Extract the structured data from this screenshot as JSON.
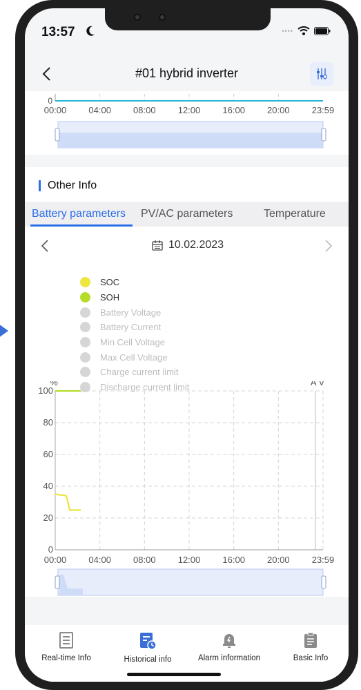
{
  "status": {
    "time": "13:57"
  },
  "header": {
    "title": "#01 hybrid inverter"
  },
  "top_chart": {
    "y_tick": "0",
    "x_ticks": [
      "00:00",
      "04:00",
      "08:00",
      "12:00",
      "16:00",
      "20:00",
      "23:59"
    ]
  },
  "section": {
    "title": "Other Info"
  },
  "tabs": [
    {
      "label": "Battery parameters",
      "active": true
    },
    {
      "label": "PV/AC parameters",
      "active": false
    },
    {
      "label": "Temperature",
      "active": false
    }
  ],
  "date": {
    "value": "10.02.2023"
  },
  "legend": [
    {
      "label": "SOC",
      "enabled": true,
      "color": "#ece63f"
    },
    {
      "label": "SOH",
      "enabled": true,
      "color": "#b5dc2a"
    },
    {
      "label": "Battery Voltage",
      "enabled": false,
      "color": "#d6d6d6"
    },
    {
      "label": "Battery Current",
      "enabled": false,
      "color": "#d6d6d6"
    },
    {
      "label": "Min Cell Voltage",
      "enabled": false,
      "color": "#d6d6d6"
    },
    {
      "label": "Max Cell Voltage",
      "enabled": false,
      "color": "#d6d6d6"
    },
    {
      "label": "Charge current limit",
      "enabled": false,
      "color": "#d6d6d6"
    },
    {
      "label": "Discharge current limit",
      "enabled": false,
      "color": "#d6d6d6"
    }
  ],
  "chart_data": {
    "type": "line",
    "ylabel_left": "%",
    "ylabel_right": "A V",
    "x_ticks": [
      "00:00",
      "04:00",
      "08:00",
      "12:00",
      "16:00",
      "20:00",
      "23:59"
    ],
    "y_ticks": [
      0,
      20,
      40,
      60,
      80,
      100
    ],
    "ylim": [
      0,
      100
    ],
    "xlim_hours": [
      0,
      24
    ],
    "grid": true,
    "series": [
      {
        "name": "SOC",
        "color": "#ece63f",
        "x_hours": [
          0,
          1.0,
          1.3,
          2.3
        ],
        "y": [
          35,
          34,
          25,
          25
        ]
      },
      {
        "name": "SOH",
        "color": "#b5dc2a",
        "x_hours": [
          0,
          2.3
        ],
        "y": [
          100,
          100
        ]
      }
    ]
  },
  "bottom_nav": [
    {
      "label": "Real-time Info",
      "active": false
    },
    {
      "label": "Historical info",
      "active": true
    },
    {
      "label": "Alarm information",
      "active": false
    },
    {
      "label": "Basic Info",
      "active": false
    }
  ],
  "colors": {
    "accent": "#2a6ee8",
    "inactive_icon": "#8a8a8a"
  }
}
